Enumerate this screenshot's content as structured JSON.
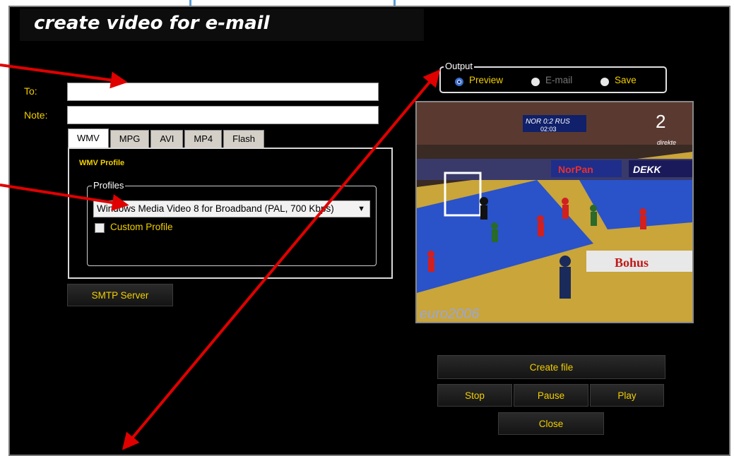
{
  "window": {
    "title": "create video for e-mail"
  },
  "form": {
    "to_label": "To:",
    "to_value": "",
    "note_label": "Note:",
    "note_value": ""
  },
  "tabs": [
    {
      "label": "WMV",
      "active": true
    },
    {
      "label": "MPG",
      "active": false
    },
    {
      "label": "AVI",
      "active": false
    },
    {
      "label": "MP4",
      "active": false
    },
    {
      "label": "Flash",
      "active": false
    }
  ],
  "wmv_panel": {
    "section_title": "WMV Profile",
    "profiles_legend": "Profiles",
    "selected_profile": "Windows Media Video 8 for Broadband (PAL, 700 Kbps)",
    "custom_profile_label": "Custom Profile",
    "custom_profile_checked": false
  },
  "smtp_button": "SMTP Server",
  "output": {
    "legend": "Output",
    "options": [
      {
        "label": "Preview",
        "selected": true,
        "enabled": true
      },
      {
        "label": "E-mail",
        "selected": false,
        "enabled": false
      },
      {
        "label": "Save",
        "selected": false,
        "enabled": true
      }
    ]
  },
  "video_preview": {
    "scoreboard": "NOR 0:2 RUS",
    "clock": "02:03",
    "channel_tag": "direkte",
    "channel_number": "2",
    "ad_texts": [
      "NorPan",
      "DEKK",
      "Bohus",
      "euro2006"
    ]
  },
  "buttons": {
    "create_file": "Create file",
    "stop": "Stop",
    "pause": "Pause",
    "play": "Play",
    "close": "Close"
  },
  "colors": {
    "accent_yellow": "#f2cf00",
    "annotation_red": "#e00000",
    "radio_blue": "#3a6fcf",
    "court_yellow": "#d9b43a",
    "court_blue": "#2a52c9"
  }
}
